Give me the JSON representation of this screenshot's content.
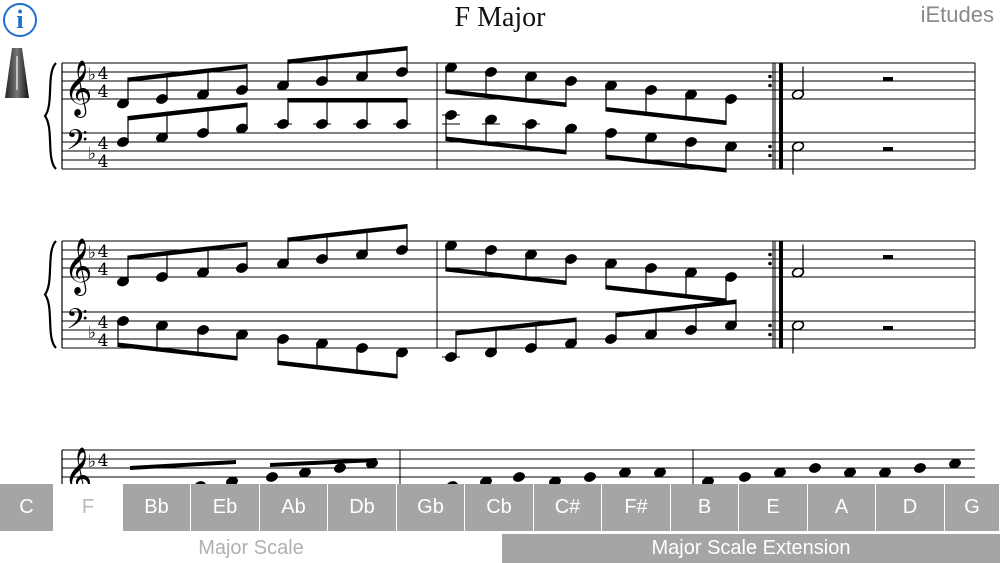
{
  "app": {
    "brand": "iEtudes",
    "info_label": "i"
  },
  "score": {
    "title": "F Major"
  },
  "keys": [
    "C",
    "F",
    "Bb",
    "Eb",
    "Ab",
    "Db",
    "Gb",
    "Cb",
    "C#",
    "F#",
    "B",
    "E",
    "A",
    "D",
    "G"
  ],
  "selected_key": "F",
  "modes": [
    {
      "label": "Major Scale",
      "active": false
    },
    {
      "label": "Major Scale Extension",
      "active": true
    }
  ],
  "colors": {
    "accent": "#1a6fd0",
    "tab_bg": "#a5a5a7",
    "tab_text": "#ffffff",
    "selected_text": "#b9b9b9"
  }
}
